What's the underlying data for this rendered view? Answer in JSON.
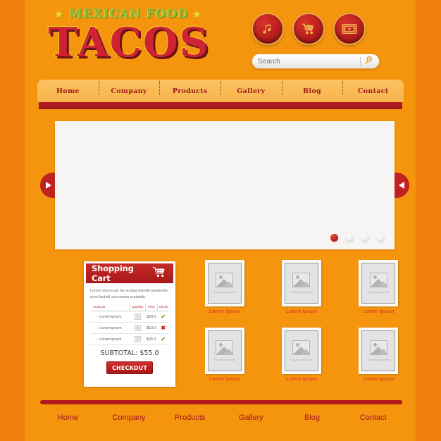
{
  "site": {
    "logo_top": "MEXICAN FOOD",
    "logo_main": "TACOS",
    "star_left": "★",
    "star_right": "★"
  },
  "header": {
    "icons": [
      {
        "name": "music-icon",
        "label": "Music"
      },
      {
        "name": "cart-icon",
        "label": "Shopping Cart"
      },
      {
        "name": "video-icon",
        "label": "Video"
      }
    ],
    "search": {
      "placeholder": "Search",
      "value": "",
      "button_icon": "search-icon"
    }
  },
  "nav": {
    "items": [
      "Home",
      "Company",
      "Products",
      "Gallery",
      "Blog",
      "Contact"
    ]
  },
  "slider": {
    "prev_icon": "arrow-right-icon",
    "next_icon": "arrow-left-icon",
    "dots": [
      {
        "active": true
      },
      {
        "active": false
      },
      {
        "active": false
      },
      {
        "active": false
      }
    ]
  },
  "cart": {
    "title": "Shopping Cart",
    "icon": "cart-icon",
    "description": "Lorem ipsum ad his scripta blandit partiendo, eum fastidii accumsan euripidis.",
    "columns": [
      "Products",
      "Quantity",
      "Price",
      "Check"
    ],
    "rows": [
      {
        "product": "- Lorem ipsum",
        "quantity": "2",
        "price": "$20.0",
        "check": "✔",
        "check_state": "ok"
      },
      {
        "product": "- Lorem ipsum",
        "quantity": "1",
        "price": "$10.0",
        "check": "✖",
        "check_state": "no"
      },
      {
        "product": "- Lorem ipsum",
        "quantity": "2",
        "price": "$25.0",
        "check": "✔",
        "check_state": "ok"
      }
    ],
    "subtotal": "SUBTOTAL: $55.0",
    "checkout_label": "CHECKOUT"
  },
  "gallery": {
    "placeholder_text": "Put your photo here",
    "items": [
      {
        "caption": "Lorem Ipsum"
      },
      {
        "caption": "Lorem Ipsum"
      },
      {
        "caption": "Lorem Ipsum"
      },
      {
        "caption": "Lorem Ipsum"
      },
      {
        "caption": "Lorem Ipsum"
      },
      {
        "caption": "Lorem Ipsum"
      }
    ]
  },
  "footer": {
    "items": [
      "Home",
      "Company",
      "Products",
      "Gallery",
      "Blog",
      "Contact"
    ]
  },
  "colors": {
    "background": "#f5940d",
    "background_edge": "#ee7f0b",
    "red": "#b3181c",
    "nav_orange": "#f8b44a",
    "green": "#9aba34",
    "yellow": "#f2d22a",
    "caption_red": "#e2482a"
  }
}
